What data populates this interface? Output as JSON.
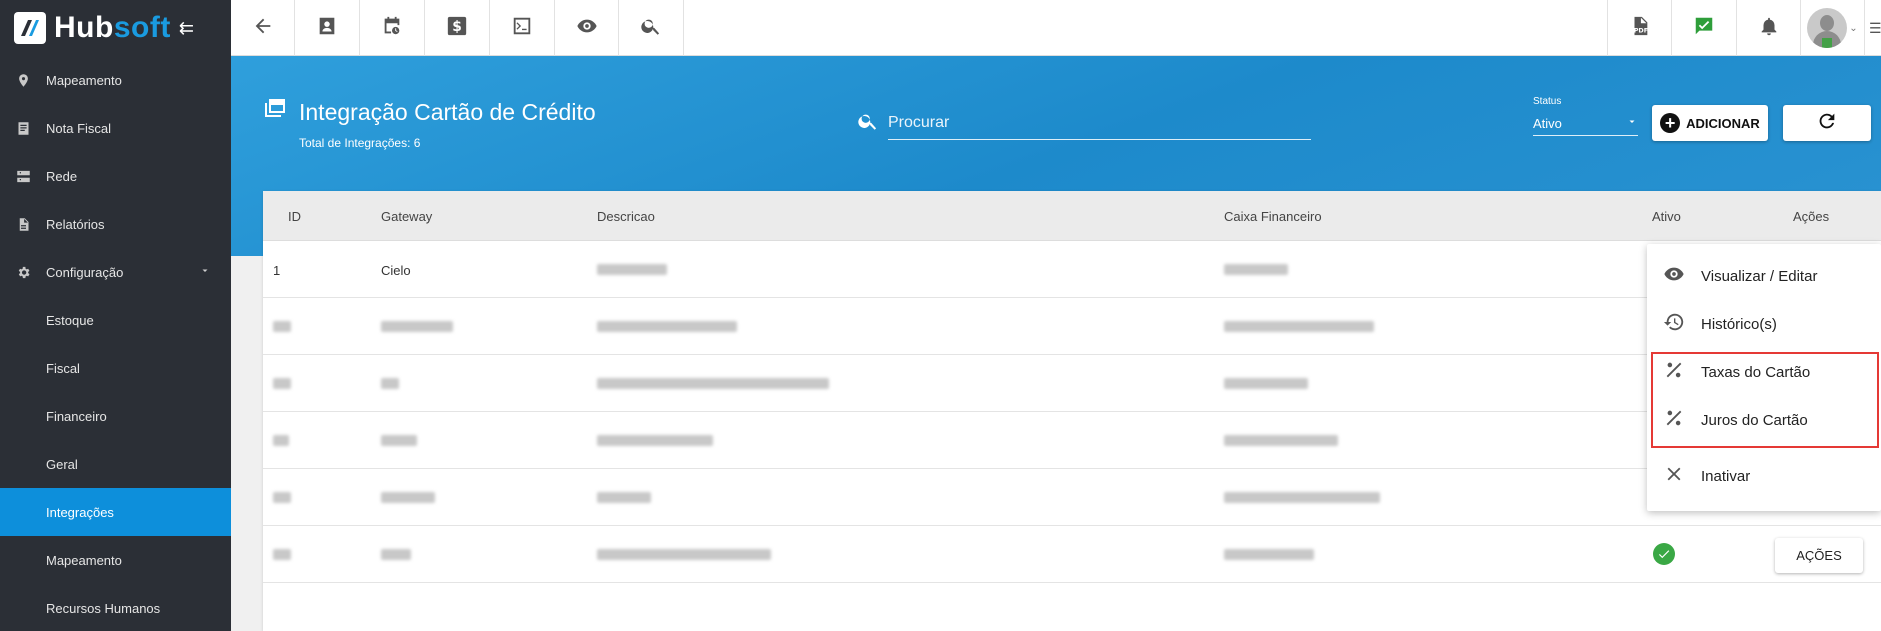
{
  "app": {
    "brand_part1": "Hub",
    "brand_part2": "soft"
  },
  "sidebar": {
    "items": [
      {
        "label": "Mapeamento",
        "icon": "map-pin-icon"
      },
      {
        "label": "Nota Fiscal",
        "icon": "receipt-icon"
      },
      {
        "label": "Rede",
        "icon": "server-icon"
      },
      {
        "label": "Relatórios",
        "icon": "report-icon"
      },
      {
        "label": "Configuração",
        "icon": "gear-icon"
      }
    ],
    "sub_items": [
      "Estoque",
      "Fiscal",
      "Financeiro",
      "Geral",
      "Integrações",
      "Mapeamento",
      "Recursos Humanos"
    ],
    "active_sub": "Integrações"
  },
  "topbar": {
    "icons": [
      "back-arrow-icon",
      "contact-icon",
      "schedule-icon",
      "dollar-icon",
      "terminal-icon",
      "eye-icon",
      "search-icon",
      "pdf-icon",
      "chat-check-icon",
      "bell-icon",
      "avatar",
      "list-icon"
    ]
  },
  "header": {
    "title": "Integração Cartão de Crédito",
    "subtitle": "Total de Integrações: 6",
    "search_placeholder": "Procurar",
    "status_label": "Status",
    "status_value": "Ativo",
    "add_label": "ADICIONAR"
  },
  "table": {
    "columns": [
      "ID",
      "Gateway",
      "Descricao",
      "Caixa Financeiro",
      "Ativo",
      "Ações"
    ],
    "first_row": {
      "id": "1",
      "gateway": "Cielo"
    },
    "last_row_action": "AÇÕES"
  },
  "menu": {
    "items": [
      {
        "label": "Visualizar / Editar",
        "icon": "eye-icon"
      },
      {
        "label": "Histórico(s)",
        "icon": "history-icon"
      },
      {
        "label": "Taxas do Cartão",
        "icon": "percent-icon"
      },
      {
        "label": "Juros do Cartão",
        "icon": "percent-icon"
      },
      {
        "label": "Inativar",
        "icon": "close-icon"
      }
    ]
  },
  "colors": {
    "accent": "#0d8fdb",
    "sidebar": "#2b2f36",
    "band": "#2594d4",
    "highlight": "#e53935",
    "success": "#3aa845"
  }
}
